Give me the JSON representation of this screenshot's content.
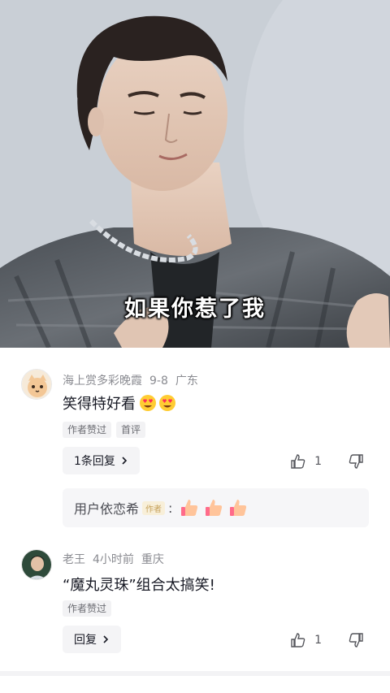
{
  "video": {
    "subtitle": "如果你惹了我"
  },
  "comments": [
    {
      "username": "海上赏多彩晚霞",
      "date": "9-8",
      "location": "广东",
      "text": "笑得特好看",
      "emojis": [
        "heart-eyes-emoji",
        "heart-eyes-emoji"
      ],
      "tags": [
        "作者赞过",
        "首评"
      ],
      "reply_button": "1条回复",
      "likes": "1",
      "sub_reply": {
        "username": "用户依恋希",
        "badge": "作者",
        "separator": ":",
        "emojis": [
          "thumbs-up-emoji",
          "thumbs-up-emoji",
          "thumbs-up-emoji"
        ]
      }
    },
    {
      "username": "老王",
      "date": "4小时前",
      "location": "重庆",
      "text": "“魔丸灵珠”组合太搞笑!",
      "tags": [
        "作者赞过"
      ],
      "reply_button": "回复",
      "likes": "1"
    }
  ],
  "colors": {
    "text_primary": "#161823",
    "text_secondary": "#8a8b91",
    "chip_bg": "#f4f4f6"
  }
}
